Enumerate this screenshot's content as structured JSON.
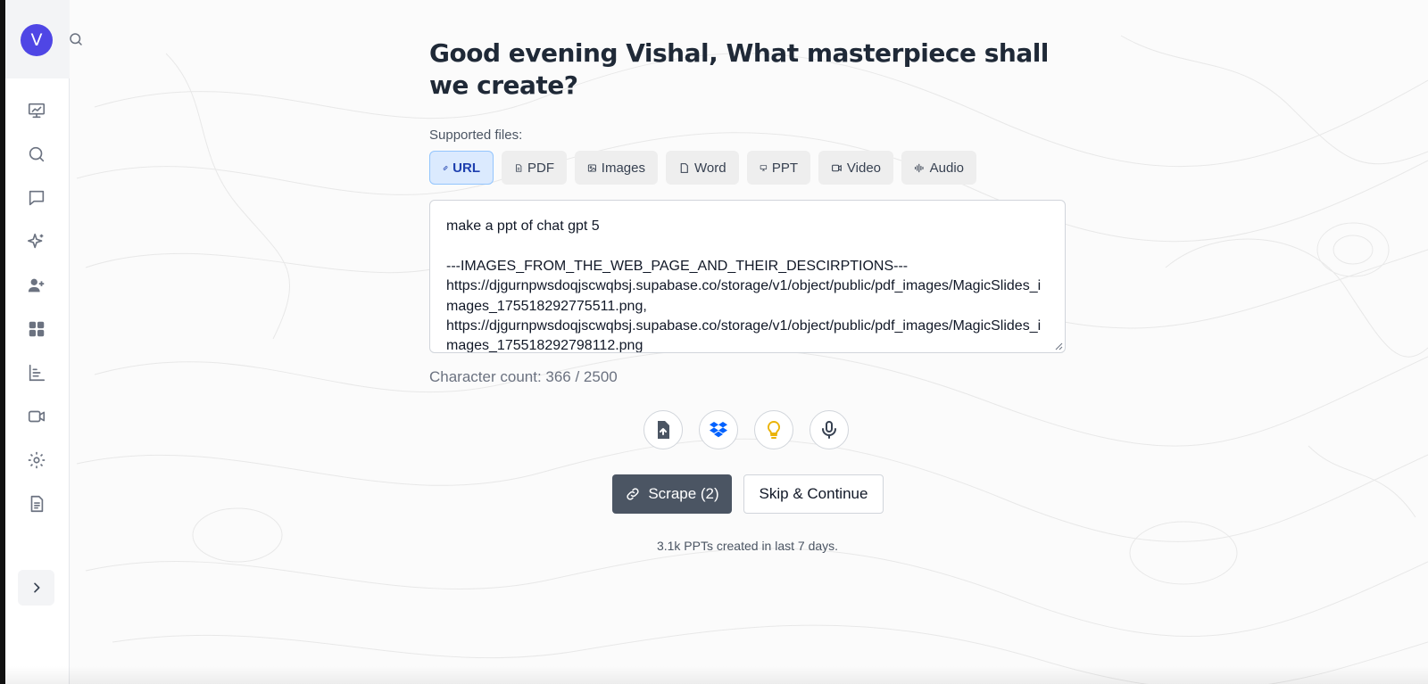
{
  "user": {
    "avatar_initial": "V"
  },
  "sidebar": {
    "items": [
      {
        "name": "presentation-icon"
      },
      {
        "name": "search-icon"
      },
      {
        "name": "chat-icon"
      },
      {
        "name": "sparkles-icon"
      },
      {
        "name": "add-user-icon"
      },
      {
        "name": "grid-icon"
      },
      {
        "name": "bar-chart-icon"
      },
      {
        "name": "video-icon"
      },
      {
        "name": "gear-icon"
      },
      {
        "name": "document-icon"
      }
    ],
    "expand_icon": "chevron-right-icon"
  },
  "main": {
    "headline": "Good evening Vishal, What masterpiece shall we create?",
    "supported_label": "Supported files:",
    "file_types": [
      {
        "label": "URL",
        "icon": "link-icon",
        "active": true
      },
      {
        "label": "PDF",
        "icon": "file-icon",
        "active": false
      },
      {
        "label": "Images",
        "icon": "image-icon",
        "active": false
      },
      {
        "label": "Word",
        "icon": "file-icon",
        "active": false
      },
      {
        "label": "PPT",
        "icon": "presentation-icon",
        "active": false
      },
      {
        "label": "Video",
        "icon": "video-icon",
        "active": false
      },
      {
        "label": "Audio",
        "icon": "audio-wave-icon",
        "active": false
      }
    ],
    "prompt_value": "make a ppt of chat gpt 5\n\n---IMAGES_FROM_THE_WEB_PAGE_AND_THEIR_DESCIRPTIONS---\nhttps://djgurnpwsdoqjscwqbsj.supabase.co/storage/v1/object/public/pdf_images/MagicSlides_images_17551829277551​1.png,\nhttps://djgurnpwsdoqjscwqbsj.supabase.co/storage/v1/object/public/pdf_images/MagicSlides_images_175518292798112.png",
    "char_count": "Character count: 366 / 2500",
    "tool_buttons": [
      "upload-file-icon",
      "dropbox-icon",
      "lightbulb-icon",
      "microphone-icon"
    ],
    "scrape_label": "Scrape (2)",
    "skip_label": "Skip & Continue",
    "stats_text": "3.1k PPTs created in last 7 days."
  },
  "colors": {
    "accent": "#4f46e5",
    "active_chip_bg": "#dbeafe",
    "active_chip_text": "#1e40af",
    "primary_button": "#4b5563",
    "dropbox": "#0061fe",
    "lightbulb": "#eab308"
  }
}
